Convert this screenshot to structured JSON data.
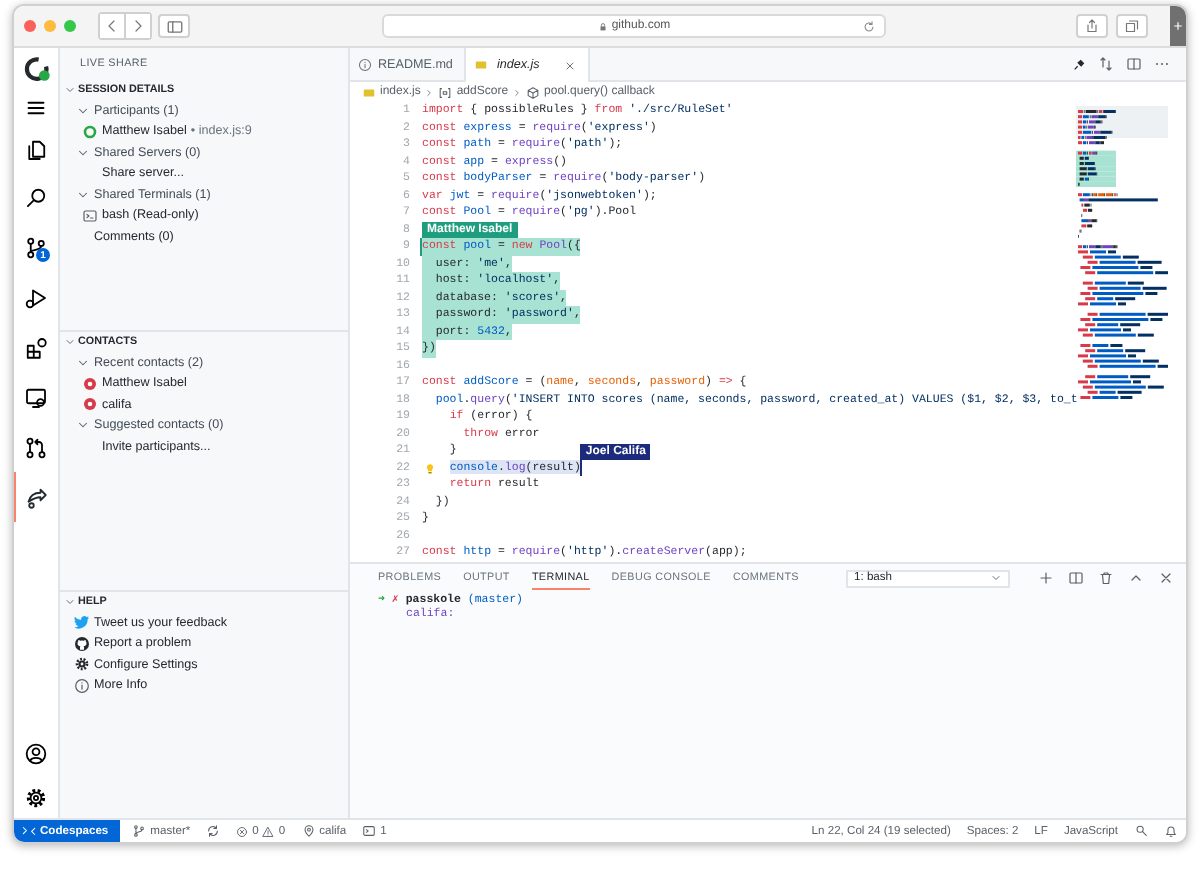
{
  "browser": {
    "url": "github.com"
  },
  "activity_bar": {
    "top": [
      {
        "kind": "logo",
        "selected": false
      },
      {
        "kind": "menu",
        "selected": false
      },
      {
        "kind": "files",
        "selected": false
      },
      {
        "kind": "search",
        "selected": false
      },
      {
        "kind": "branch",
        "selected": false,
        "badge": "1"
      },
      {
        "kind": "run",
        "selected": false
      },
      {
        "kind": "extensions",
        "selected": false
      },
      {
        "kind": "remote",
        "selected": false
      },
      {
        "kind": "pull-request",
        "selected": false
      },
      {
        "kind": "share",
        "selected": true
      }
    ],
    "bottom": [
      {
        "kind": "account",
        "selected": false
      },
      {
        "kind": "settings",
        "selected": false
      }
    ]
  },
  "sidebar": {
    "title": "LIVE SHARE",
    "sections": [
      {
        "title": "SESSION DETAILS",
        "expanded": true,
        "items": [
          {
            "label": "Participants (1)",
            "expanded": true,
            "children": [
              {
                "kind": "participant",
                "label": "Matthew Isabel",
                "detail": "• index.js:9"
              }
            ]
          },
          {
            "label": "Shared Servers (0)",
            "expanded": true,
            "children": [
              {
                "kind": "action",
                "label": "Share server..."
              }
            ]
          },
          {
            "label": "Shared Terminals (1)",
            "expanded": true,
            "children": [
              {
                "kind": "terminal",
                "label": "bash (Read-only)"
              }
            ]
          },
          {
            "kind": "plain",
            "label": "Comments (0)"
          }
        ]
      },
      {
        "title": "CONTACTS",
        "expanded": true,
        "items": [
          {
            "label": "Recent contacts (2)",
            "expanded": true,
            "children": [
              {
                "kind": "contact",
                "label": "Matthew Isabel"
              },
              {
                "kind": "contact",
                "label": "califa"
              }
            ]
          },
          {
            "label": "Suggested contacts (0)",
            "expanded": true,
            "children": [
              {
                "kind": "action",
                "label": "Invite participants..."
              }
            ]
          }
        ]
      },
      {
        "title": "HELP",
        "expanded": true,
        "items": [
          {
            "kind": "twitter",
            "label": "Tweet us your feedback"
          },
          {
            "kind": "github",
            "label": "Report a problem"
          },
          {
            "kind": "gear",
            "label": "Configure Settings"
          },
          {
            "kind": "info",
            "label": "More Info"
          }
        ]
      }
    ]
  },
  "editor": {
    "tabs": [
      {
        "label": "README.md",
        "kind": "info",
        "selected": false,
        "preview": false
      },
      {
        "label": "index.js",
        "kind": "js",
        "selected": true,
        "preview": true
      }
    ],
    "breadcrumb": [
      {
        "label": "index.js",
        "kind": "js"
      },
      {
        "label": "addScore",
        "kind": "variable"
      },
      {
        "label": "pool.query() callback",
        "kind": "function"
      }
    ],
    "lines": [
      {
        "number": "1",
        "selected": false,
        "text": "import { possibleRules } from './src/RuleSet'"
      },
      {
        "number": "2",
        "selected": false,
        "text": "const express = require('express')"
      },
      {
        "number": "3",
        "selected": false,
        "text": "const path = require('path');"
      },
      {
        "number": "4",
        "selected": false,
        "text": "const app = express()"
      },
      {
        "number": "5",
        "selected": false,
        "text": "const bodyParser = require('body-parser')"
      },
      {
        "number": "6",
        "selected": false,
        "text": "var jwt = require('jsonwebtoken');"
      },
      {
        "number": "7",
        "selected": false,
        "text": "const Pool = require('pg').Pool"
      },
      {
        "number": "8",
        "selected": false
      },
      {
        "number": "9",
        "selected": true,
        "flag": {
          "name": "Matthew Isabel",
          "color": "#1f9e7f",
          "at_end": false
        },
        "text": "const pool = new Pool({"
      },
      {
        "number": "10",
        "selected": true,
        "text": "  user: 'me',"
      },
      {
        "number": "11",
        "selected": true,
        "text": "  host: 'localhost',"
      },
      {
        "number": "12",
        "selected": true,
        "text": "  database: 'scores',"
      },
      {
        "number": "13",
        "selected": true,
        "text": "  password: 'password',"
      },
      {
        "number": "14",
        "selected": true,
        "text": "  port: 5432,"
      },
      {
        "number": "15",
        "selected": true,
        "text": "})"
      },
      {
        "number": "16",
        "selected": false
      },
      {
        "number": "17",
        "selected": false,
        "text": "const addScore = (name, seconds, password) => {"
      },
      {
        "number": "18",
        "selected": false,
        "text": "  pool.query('INSERT INTO scores (name, seconds, password, created_at) VALUES ($1, $2, $3, to_t"
      },
      {
        "number": "19",
        "selected": false,
        "text": "    if (error) {"
      },
      {
        "number": "20",
        "selected": false,
        "text": "      throw error"
      },
      {
        "number": "21",
        "selected": false,
        "text": "    }"
      },
      {
        "number": "22",
        "selected": false,
        "marked": true,
        "lightbulb": true,
        "flag": {
          "name": "Joel Califa",
          "color": "#1d2b7d",
          "at_end": true
        },
        "text": "    console.log(result)"
      },
      {
        "number": "23",
        "selected": false,
        "text": "    return result"
      },
      {
        "number": "24",
        "selected": false,
        "text": "  })"
      },
      {
        "number": "25",
        "selected": false,
        "text": "}"
      },
      {
        "number": "26",
        "selected": false
      },
      {
        "number": "27",
        "selected": false,
        "text": "const http = require('http').createServer(app);"
      }
    ]
  },
  "panel": {
    "tabs": [
      {
        "label": "PROBLEMS",
        "selected": false
      },
      {
        "label": "OUTPUT",
        "selected": false
      },
      {
        "label": "TERMINAL",
        "selected": true
      },
      {
        "label": "DEBUG CONSOLE",
        "selected": false
      },
      {
        "label": "COMMENTS",
        "selected": false
      }
    ],
    "terminal_select": "1: bash",
    "terminal": {
      "arrow": "➜",
      "status": "✗",
      "directory": "passkole",
      "branch": "(master)",
      "input": "califa:"
    }
  },
  "status_bar": {
    "left": [
      {
        "kind": "remote",
        "label": "Codespaces"
      },
      {
        "kind": "branch",
        "label": "master*"
      },
      {
        "kind": "sync"
      },
      {
        "kind": "problems",
        "errors": "0",
        "warnings": "0"
      },
      {
        "kind": "person",
        "label": "califa"
      },
      {
        "kind": "terminal",
        "label": "1"
      }
    ],
    "right": [
      {
        "kind": "text",
        "label": "Ln 22, Col 24 (19 selected)"
      },
      {
        "kind": "text",
        "label": "Spaces: 2"
      },
      {
        "kind": "text",
        "label": "LF"
      },
      {
        "kind": "text",
        "label": "JavaScript"
      },
      {
        "kind": "feedback"
      },
      {
        "kind": "bell"
      }
    ]
  }
}
